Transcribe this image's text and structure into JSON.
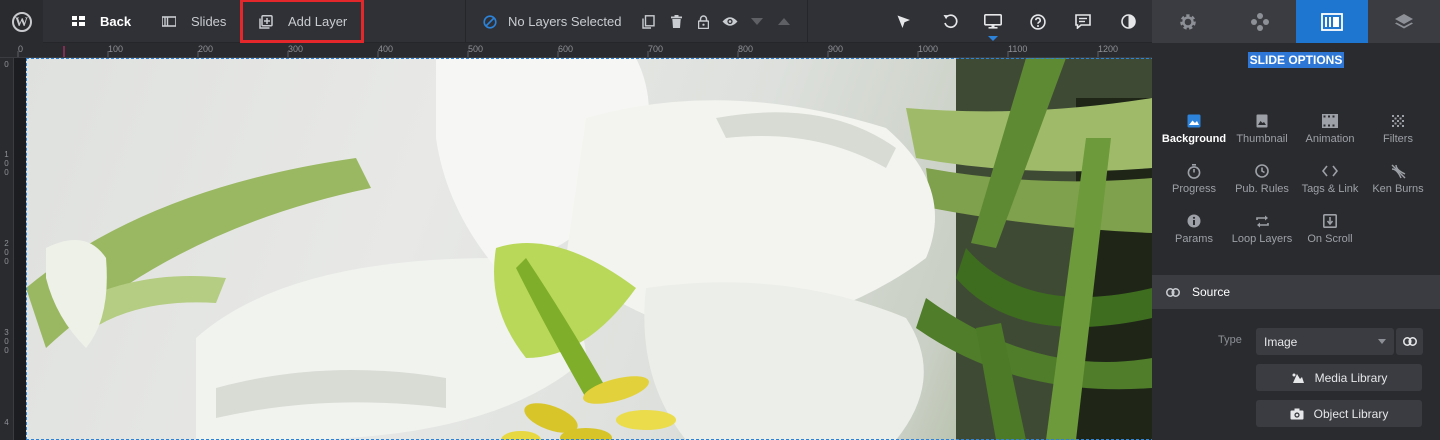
{
  "toolbar": {
    "back_label": "Back",
    "slides_label": "Slides",
    "add_layer_label": "Add Layer",
    "layers_status": "No Layers Selected"
  },
  "ruler": {
    "top_labels": [
      "0",
      "100",
      "200",
      "300",
      "400",
      "500",
      "600",
      "700",
      "800",
      "900",
      "1000",
      "1100",
      "1200"
    ],
    "left_labels": [
      [
        "0"
      ],
      [
        "1",
        "0",
        "0"
      ],
      [
        "2",
        "0",
        "0"
      ],
      [
        "3",
        "0",
        "0"
      ],
      [
        "4"
      ]
    ]
  },
  "panel": {
    "title": "SLIDE OPTIONS",
    "options": [
      {
        "label": "Background",
        "icon": "image-icon",
        "active": true
      },
      {
        "label": "Thumbnail",
        "icon": "thumbnail-icon",
        "active": false
      },
      {
        "label": "Animation",
        "icon": "film-icon",
        "active": false
      },
      {
        "label": "Filters",
        "icon": "filters-icon",
        "active": false
      },
      {
        "label": "Progress",
        "icon": "stopwatch-icon",
        "active": false
      },
      {
        "label": "Pub. Rules",
        "icon": "clock-icon",
        "active": false
      },
      {
        "label": "Tags & Link",
        "icon": "code-icon",
        "active": false
      },
      {
        "label": "Ken Burns",
        "icon": "ken-burns-icon",
        "active": false
      },
      {
        "label": "Params",
        "icon": "info-icon",
        "active": false
      },
      {
        "label": "Loop Layers",
        "icon": "loop-icon",
        "active": false
      },
      {
        "label": "On Scroll",
        "icon": "scroll-icon",
        "active": false
      }
    ],
    "source_label": "Source",
    "type_label": "Type",
    "type_value": "Image",
    "media_library_label": "Media Library",
    "object_library_label": "Object Library"
  },
  "colors": {
    "accent": "#1f76d0",
    "highlight_box": "#e3272b",
    "toolbar_bg": "#2f3136",
    "panel_bg": "#2a2b2f"
  }
}
